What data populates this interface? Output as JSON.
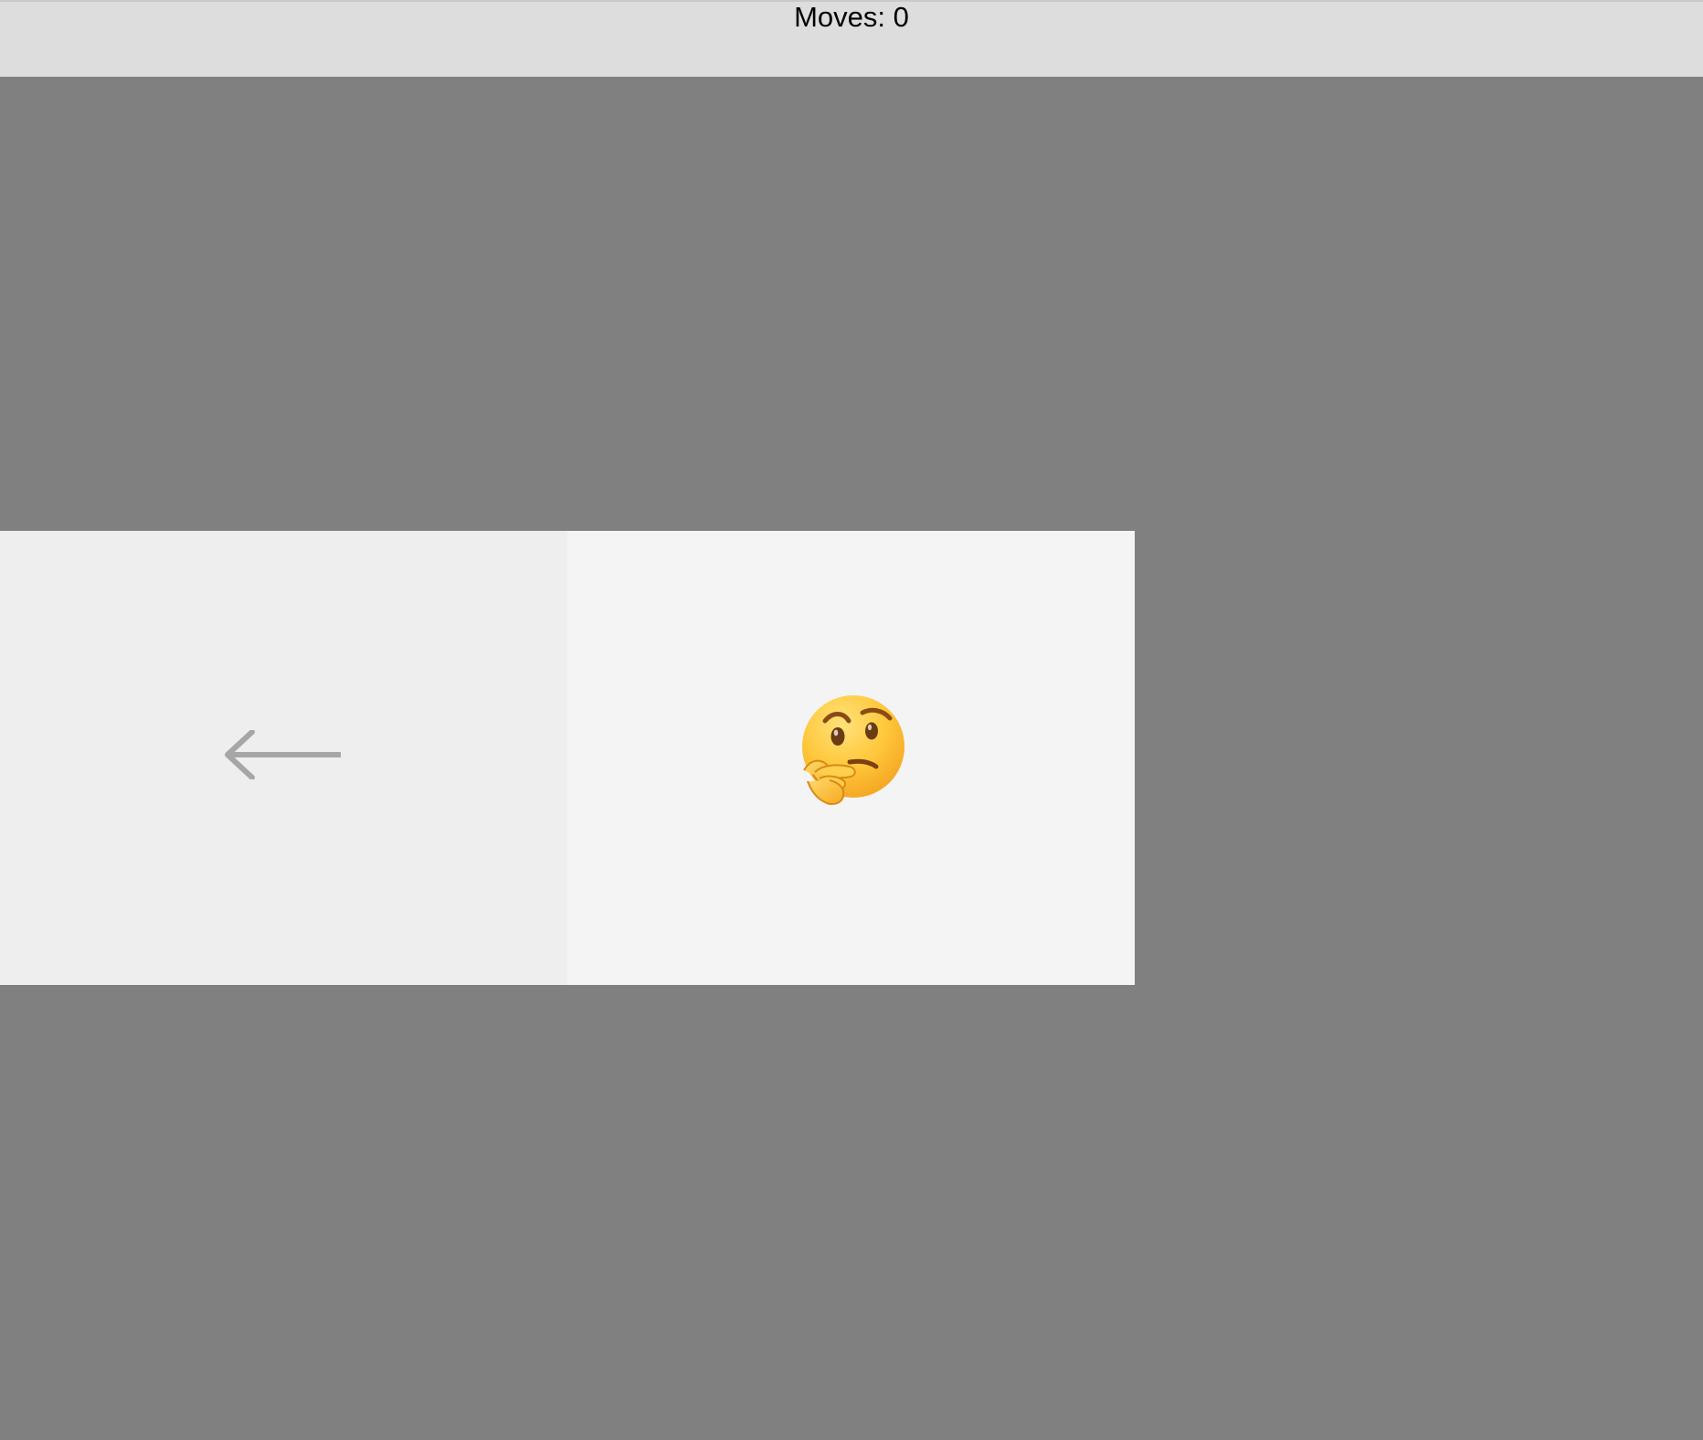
{
  "status": {
    "moves_label": "Moves: 0"
  },
  "board": {
    "tiles": [
      {
        "type": "arrow",
        "icon": "left-arrow-icon"
      },
      {
        "type": "player",
        "icon": "thinking-face-icon"
      }
    ]
  },
  "colors": {
    "background": "#808080",
    "top_bar": "#dddddd",
    "tile_left": "#eeeeee",
    "tile_center": "#f4f4f4",
    "arrow": "#a6a6a6"
  }
}
